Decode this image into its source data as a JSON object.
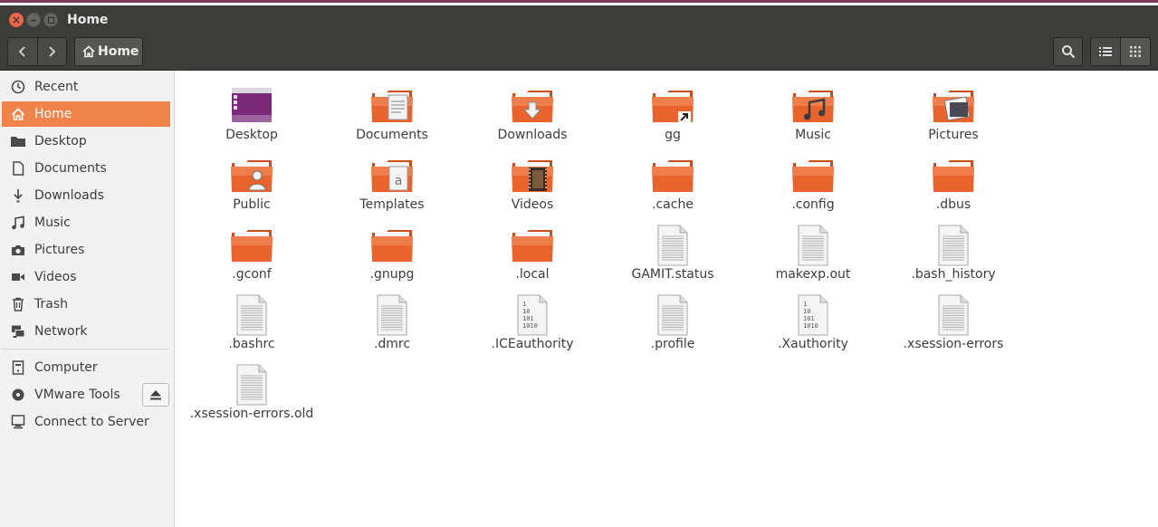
{
  "window": {
    "title": "Home"
  },
  "toolbar": {
    "path_label": "Home"
  },
  "sidebar": {
    "items": [
      {
        "label": "Recent",
        "icon": "clock-icon"
      },
      {
        "label": "Home",
        "icon": "home-icon"
      },
      {
        "label": "Desktop",
        "icon": "folder-icon"
      },
      {
        "label": "Documents",
        "icon": "document-icon"
      },
      {
        "label": "Downloads",
        "icon": "download-icon"
      },
      {
        "label": "Music",
        "icon": "music-note-icon"
      },
      {
        "label": "Pictures",
        "icon": "camera-icon"
      },
      {
        "label": "Videos",
        "icon": "video-icon"
      },
      {
        "label": "Trash",
        "icon": "trash-icon"
      },
      {
        "label": "Network",
        "icon": "network-icon"
      },
      {
        "label": "Computer",
        "icon": "computer-icon"
      },
      {
        "label": "VMware Tools",
        "icon": "disc-icon"
      },
      {
        "label": "Connect to Server",
        "icon": "server-icon"
      }
    ]
  },
  "files": [
    {
      "name": "Desktop",
      "type": "desktop-folder"
    },
    {
      "name": "Documents",
      "type": "folder-documents"
    },
    {
      "name": "Downloads",
      "type": "folder-downloads"
    },
    {
      "name": "gg",
      "type": "folder-link"
    },
    {
      "name": "Music",
      "type": "folder-music"
    },
    {
      "name": "Pictures",
      "type": "folder-pictures"
    },
    {
      "name": "Public",
      "type": "folder-public"
    },
    {
      "name": "Templates",
      "type": "folder-templates"
    },
    {
      "name": "Videos",
      "type": "folder-videos"
    },
    {
      "name": ".cache",
      "type": "folder"
    },
    {
      "name": ".config",
      "type": "folder"
    },
    {
      "name": ".dbus",
      "type": "folder"
    },
    {
      "name": ".gconf",
      "type": "folder"
    },
    {
      "name": ".gnupg",
      "type": "folder"
    },
    {
      "name": ".local",
      "type": "folder"
    },
    {
      "name": "GAMIT.status",
      "type": "text-file"
    },
    {
      "name": "makexp.out",
      "type": "text-file"
    },
    {
      "name": ".bash_history",
      "type": "text-file"
    },
    {
      "name": ".bashrc",
      "type": "text-file"
    },
    {
      "name": ".dmrc",
      "type": "text-file"
    },
    {
      "name": ".ICEauthority",
      "type": "binary-file"
    },
    {
      "name": ".profile",
      "type": "text-file"
    },
    {
      "name": ".Xauthority",
      "type": "binary-file"
    },
    {
      "name": ".xsession-errors",
      "type": "text-file"
    },
    {
      "name": ".xsession-errors.old",
      "type": "text-file"
    }
  ],
  "binary_glyph_lines": [
    "1",
    "10",
    "101",
    "1010"
  ],
  "template_glyph": "a",
  "colors": {
    "accent": "#f0834a",
    "titlebar": "#3d3c38",
    "folder": "#e9642c",
    "desktop_folder": "#7b2a7a"
  }
}
